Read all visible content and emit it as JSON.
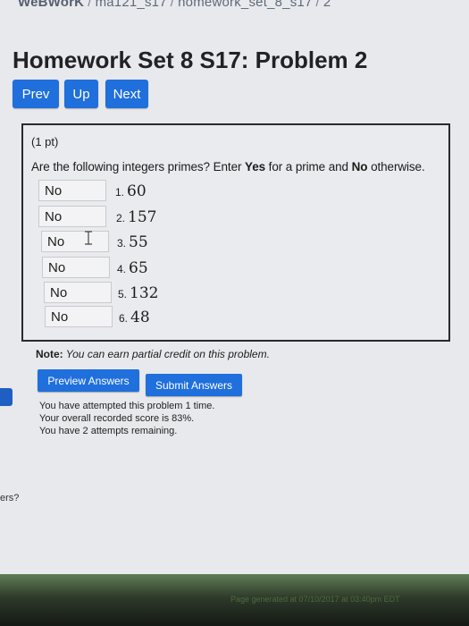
{
  "breadcrumb": {
    "home": "WeBWorK",
    "course": "ma121_s17",
    "set": "homework_set_8_s17",
    "problem": "2"
  },
  "page": {
    "title": "Homework Set 8 S17: Problem 2"
  },
  "nav": {
    "prev": "Prev",
    "up": "Up",
    "next": "Next"
  },
  "problem": {
    "points": "(1 pt)",
    "question_pre": "Are the following integers primes? Enter ",
    "yes": "Yes",
    "question_mid": " for a prime and ",
    "no": "No",
    "question_post": " otherwise.",
    "items": [
      {
        "number": "1.",
        "value": "60",
        "answer": "No"
      },
      {
        "number": "2.",
        "value": "157",
        "answer": "No"
      },
      {
        "number": "3.",
        "value": "55",
        "answer": "No"
      },
      {
        "number": "4.",
        "value": "65",
        "answer": "No"
      },
      {
        "number": "5.",
        "value": "132",
        "answer": "No"
      },
      {
        "number": "6.",
        "value": "48",
        "answer": "No"
      }
    ]
  },
  "note": {
    "label": "Note:",
    "text": " You can earn partial credit on this problem."
  },
  "actions": {
    "preview": "Preview Answers",
    "submit": "Submit Answers"
  },
  "status": {
    "line1": "You have attempted this problem 1 time.",
    "line2": "Your overall recorded score is 83%.",
    "line3": "You have 2 attempts remaining."
  },
  "side": {
    "fragment": "ers?"
  },
  "footer": {
    "text": "Page generated at 07/10/2017 at 03:40pm EDT"
  },
  "colors": {
    "button": "#1f6fdc",
    "border": "#2a2a2a",
    "background": "#e8e9ec"
  },
  "icons": {
    "cursor": "text-cursor-icon"
  }
}
